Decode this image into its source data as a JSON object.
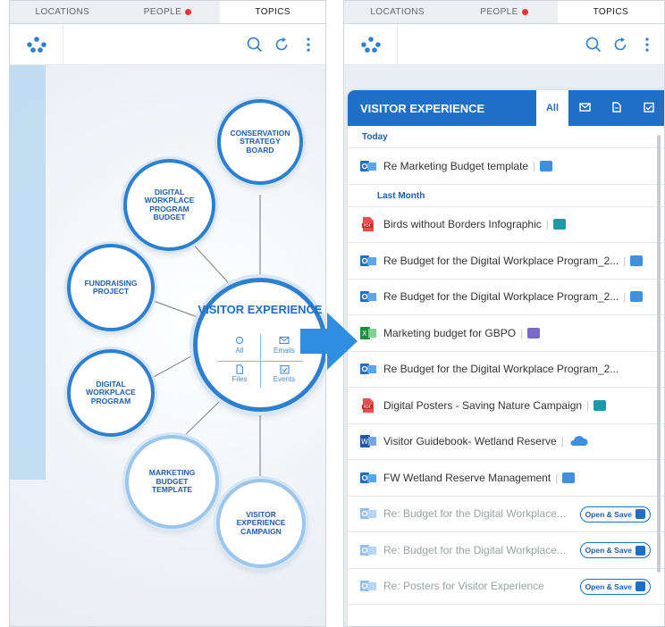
{
  "tabs": [
    {
      "label": "LOCATIONS"
    },
    {
      "label": "PEOPLE"
    },
    {
      "label": "TOPICS"
    }
  ],
  "colors": {
    "accent": "#1f6fc6",
    "bubble_border": "#2f7fd0",
    "notification": "#e53935"
  },
  "map": {
    "center": {
      "title": "VISITOR EXPERIENCE",
      "quadrants": [
        {
          "label": "All",
          "icon": "circle-icon"
        },
        {
          "label": "Emails",
          "icon": "mail-icon"
        },
        {
          "label": "Files",
          "icon": "file-icon"
        },
        {
          "label": "Events",
          "icon": "calendar-check-icon"
        }
      ]
    },
    "topics": [
      {
        "label": "CONSERVATION STRATEGY BOARD"
      },
      {
        "label": "DIGITAL WORKPLACE PROGRAM BUDGET"
      },
      {
        "label": "FUNDRAISING PROJECT"
      },
      {
        "label": "DIGITAL WORKPLACE PROGRAM"
      },
      {
        "label": "MARKETING BUDGET TEMPLATE"
      },
      {
        "label": "VISITOR EXPERIENCE CAMPAIGN"
      }
    ]
  },
  "list": {
    "title": "VISITOR EXPERIENCE",
    "filters": [
      {
        "label": "All",
        "icon": ""
      },
      {
        "label": "",
        "icon": "mail-icon"
      },
      {
        "label": "",
        "icon": "file-icon"
      },
      {
        "label": "",
        "icon": "calendar-check-icon"
      }
    ],
    "group_today": "Today",
    "group_last_month": "Last Month",
    "rows": [
      {
        "label": "Re Marketing Budget template",
        "file": "outlook",
        "source": "outlook"
      },
      {
        "label": "Birds without Borders Infographic",
        "file": "pdf",
        "source": "sharepoint"
      },
      {
        "label": "Re Budget for the Digital Workplace Program_2...",
        "file": "outlook",
        "source": "outlook"
      },
      {
        "label": "Re Budget for the Digital Workplace Program_2...",
        "file": "outlook",
        "source": "outlook"
      },
      {
        "label": "Marketing budget for GBPO",
        "file": "excel",
        "source": "teams"
      },
      {
        "label": "Re Budget for the Digital Workplace Program_2...",
        "file": "outlook",
        "source": ""
      },
      {
        "label": "Digital Posters - Saving Nature Campaign",
        "file": "pdf",
        "source": "sharepoint"
      },
      {
        "label": "Visitor Guidebook- Wetland Reserve",
        "file": "word",
        "source": "cloud"
      },
      {
        "label": "FW Wetland Reserve Management",
        "file": "outlook",
        "source": "outlook"
      },
      {
        "label": "Re: Budget for the Digital Workplace...",
        "file": "outlook",
        "source": "",
        "action": "Open & Save"
      },
      {
        "label": "Re: Budget for the Digital Workplace...",
        "file": "outlook",
        "source": "",
        "action": "Open & Save"
      },
      {
        "label": "Re: Posters for Visitor Experience",
        "file": "outlook",
        "source": "",
        "action": "Open & Save"
      }
    ]
  }
}
